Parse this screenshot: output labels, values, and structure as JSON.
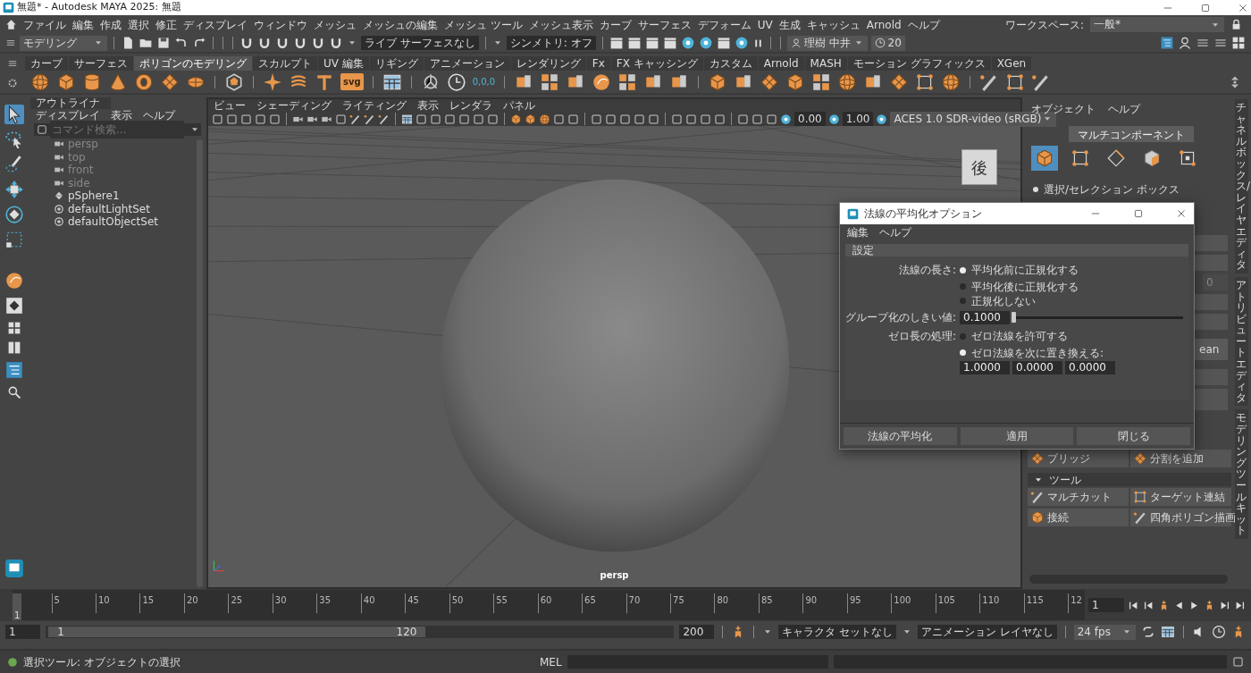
{
  "window": {
    "title": "無題* - Autodesk MAYA 2025: 無題"
  },
  "menubar": {
    "items": [
      "ファイル",
      "編集",
      "作成",
      "選択",
      "修正",
      "ディスプレイ",
      "ウィンドウ",
      "メッシュ",
      "メッシュの編集",
      "メッシュ ツール",
      "メッシュ表示",
      "カーブ",
      "サーフェス",
      "デフォーム",
      "UV",
      "生成",
      "キャッシュ",
      "Arnold",
      "ヘルプ"
    ],
    "workspace_label": "ワークスペース:",
    "workspace_value": "一般*"
  },
  "status_line": {
    "mode": "モデリング",
    "live_surface": "ライブ サーフェスなし",
    "symmetry": "シンメトリ: オフ",
    "user": "理樹 中井",
    "credits": "20"
  },
  "shelf": {
    "tabs": [
      {
        "label": "カーブ",
        "selected": false
      },
      {
        "label": "サーフェス",
        "selected": false
      },
      {
        "label": "ポリゴンのモデリング",
        "selected": true
      },
      {
        "label": "スカルプト",
        "selected": false
      },
      {
        "label": "UV 編集",
        "selected": false
      },
      {
        "label": "リギング",
        "selected": false
      },
      {
        "label": "アニメーション",
        "selected": false
      },
      {
        "label": "レンダリング",
        "selected": false
      },
      {
        "label": "Fx",
        "selected": false
      },
      {
        "label": "FX キャッシング",
        "selected": false
      },
      {
        "label": "カスタム",
        "selected": false
      },
      {
        "label": "Arnold",
        "selected": false
      },
      {
        "label": "MASH",
        "selected": false
      },
      {
        "label": "モーション グラフィックス",
        "selected": false
      },
      {
        "label": "XGen",
        "selected": false
      }
    ],
    "svg_label": "svg",
    "origin_label": "0,0,0"
  },
  "outliner": {
    "title": "アウトライナ",
    "menu": [
      "ディスプレイ",
      "表示",
      "ヘルプ"
    ],
    "search_placeholder": "コマンド検索...",
    "items": [
      {
        "label": "persp",
        "kind": "camera",
        "hidden": true
      },
      {
        "label": "top",
        "kind": "camera",
        "hidden": true
      },
      {
        "label": "front",
        "kind": "camera",
        "hidden": true
      },
      {
        "label": "side",
        "kind": "camera",
        "hidden": true
      },
      {
        "label": "pSphere1",
        "kind": "mesh",
        "hidden": false
      },
      {
        "label": "defaultLightSet",
        "kind": "set",
        "hidden": false
      },
      {
        "label": "defaultObjectSet",
        "kind": "set",
        "hidden": false
      }
    ]
  },
  "viewport": {
    "menu": [
      "ビュー",
      "シェーディング",
      "ライティング",
      "表示",
      "レンダラ",
      "パネル"
    ],
    "exposure": "0.00",
    "gamma": "1.00",
    "color_space": "ACES 1.0 SDR-video (sRGB)",
    "view_cube_label": "後",
    "camera_label": "persp"
  },
  "right_panel": {
    "menu": [
      "オブジェクト",
      "ヘルプ"
    ],
    "mode_button": "マルチコンポーネント",
    "component_modes": [
      {
        "selected": true
      },
      {
        "selected": false
      },
      {
        "selected": false
      },
      {
        "selected": false
      },
      {
        "selected": false
      }
    ],
    "selection_option": "選択/セレクション ボックス",
    "hidden_field": "0",
    "hidden_button": "ean",
    "buttons": [
      "ブリッジ",
      "分割を追加"
    ],
    "tools_section": {
      "label": "ツール",
      "expanded": true,
      "items": [
        "マルチカット",
        "ターゲット連結",
        "接続",
        "四角ポリゴン描画"
      ]
    }
  },
  "side_tabs": [
    "チャネルボックス/レイヤエディタ",
    "アトリビュートエディタ",
    "モデリングツールキット"
  ],
  "timeline": {
    "ticks": [
      "5",
      "10",
      "15",
      "20",
      "25",
      "30",
      "35",
      "40",
      "45",
      "50",
      "55",
      "60",
      "65",
      "70",
      "75",
      "80",
      "85",
      "90",
      "95",
      "100",
      "105",
      "110",
      "115",
      "12"
    ],
    "current_frame": "1",
    "frame_field": "1"
  },
  "range": {
    "level": 0.6,
    "start": "1",
    "inner_start": "1",
    "inner_end": "120",
    "end": "200",
    "character_set": "キャラクタ セットなし",
    "anim_layer": "アニメーション レイヤなし",
    "fps": "24 fps"
  },
  "status_bar": {
    "help": "選択ツール: オブジェクトの選択",
    "mel_label": "MEL"
  },
  "dialog": {
    "title": "法線の平均化オプション",
    "menu": [
      "編集",
      "ヘルプ"
    ],
    "section": "設定",
    "normal_length": {
      "label": "法線の長さ:",
      "options": [
        {
          "label": "平均化前に正規化する",
          "selected": true
        },
        {
          "label": "平均化後に正規化する",
          "selected": false
        },
        {
          "label": "正規化しない",
          "selected": false
        }
      ]
    },
    "threshold": {
      "label": "グループ化のしきい値:",
      "value": "0.1000",
      "level": 0.0
    },
    "zero_length": {
      "label": "ゼロ長の処理:",
      "options": [
        {
          "label": "ゼロ法線を許可する",
          "selected": false
        },
        {
          "label": "ゼロ法線を次に置き換える:",
          "selected": true
        }
      ],
      "values": [
        "1.0000",
        "0.0000",
        "0.0000"
      ]
    },
    "buttons": [
      "法線の平均化",
      "適用",
      "閉じる"
    ]
  }
}
